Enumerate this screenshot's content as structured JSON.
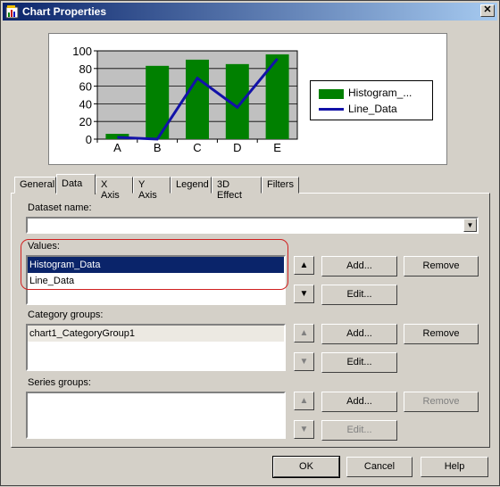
{
  "window": {
    "title": "Chart Properties",
    "close_glyph": "✕"
  },
  "chart_data": {
    "type": "bar",
    "categories": [
      "A",
      "B",
      "C",
      "D",
      "E"
    ],
    "series": [
      {
        "name": "Histogram_...",
        "type": "bar",
        "color": "#008000",
        "values": [
          6,
          83,
          90,
          85,
          96
        ]
      },
      {
        "name": "Line_Data",
        "type": "line",
        "color": "#1212a8",
        "values": [
          2,
          0,
          69,
          36,
          91
        ]
      }
    ],
    "ylim": [
      0,
      100
    ],
    "yticks": [
      "0",
      "20",
      "40",
      "60",
      "80",
      "100"
    ],
    "grid": true,
    "plot_background": "#c0c0c0",
    "legend": "right"
  },
  "tabs": [
    "General",
    "Data",
    "X Axis",
    "Y Axis",
    "Legend",
    "3D Effect",
    "Filters"
  ],
  "active_tab": "Data",
  "dataset": {
    "label": "Dataset name:",
    "value": ""
  },
  "values": {
    "label": "Values:",
    "items": [
      "Histogram_Data",
      "Line_Data"
    ],
    "selected_index": 0
  },
  "category_groups": {
    "label": "Category groups:",
    "items": [
      "chart1_CategoryGroup1"
    ]
  },
  "series_groups": {
    "label": "Series groups:",
    "items": []
  },
  "buttons": {
    "add": "Add...",
    "edit": "Edit...",
    "remove": "Remove",
    "ok": "OK",
    "cancel": "Cancel",
    "help": "Help"
  },
  "icons": {
    "up": "▲",
    "down": "▼",
    "dropdown": "▼"
  }
}
